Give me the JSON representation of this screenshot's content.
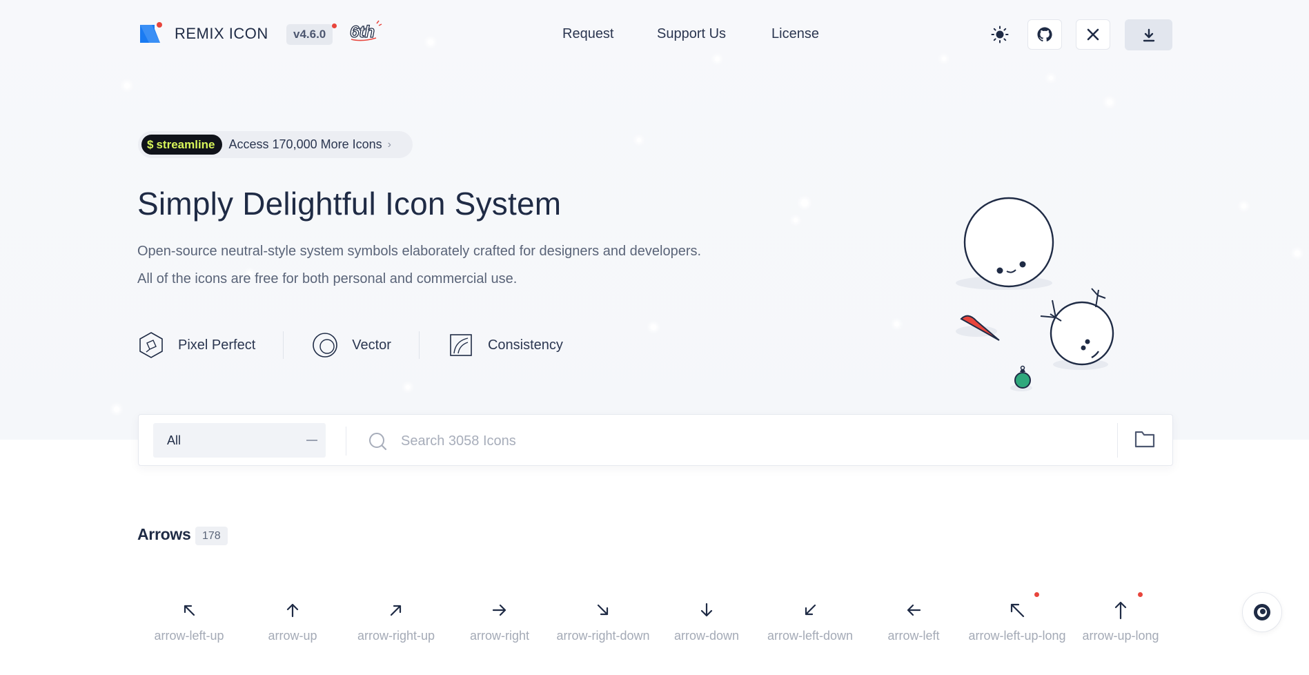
{
  "header": {
    "logo_text": "REMIX ICON",
    "version": "v4.6.0",
    "anniversary": "6th",
    "nav": [
      "Request",
      "Support Us",
      "License"
    ]
  },
  "promo": {
    "badge": "streamline",
    "text": "Access 170,000 More Icons"
  },
  "hero": {
    "title": "Simply Delightful Icon System",
    "line1": "Open-source neutral-style system symbols elaborately crafted for designers and developers.",
    "line2": "All of the icons are free for both personal and commercial use.",
    "features": [
      "Pixel Perfect",
      "Vector",
      "Consistency"
    ]
  },
  "search": {
    "category": "All",
    "placeholder": "Search 3058 Icons"
  },
  "section": {
    "title": "Arrows",
    "count": "178",
    "icons": [
      {
        "name": "arrow-left-up",
        "glyph": "↖"
      },
      {
        "name": "arrow-up",
        "glyph": "↑"
      },
      {
        "name": "arrow-right-up",
        "glyph": "↗"
      },
      {
        "name": "arrow-right",
        "glyph": "→"
      },
      {
        "name": "arrow-right-down",
        "glyph": "↘"
      },
      {
        "name": "arrow-down",
        "glyph": "↓"
      },
      {
        "name": "arrow-left-down",
        "glyph": "↙"
      },
      {
        "name": "arrow-left",
        "glyph": "←"
      },
      {
        "name": "arrow-left-up-long",
        "glyph": "↖"
      },
      {
        "name": "arrow-up-long",
        "glyph": "↑"
      }
    ]
  },
  "colors": {
    "text": "#1f2b45",
    "muted": "#a4aab6",
    "accent_red": "#e8453c",
    "logo_blue": "#1a7bf2",
    "streamline_green": "#d7f55a"
  }
}
